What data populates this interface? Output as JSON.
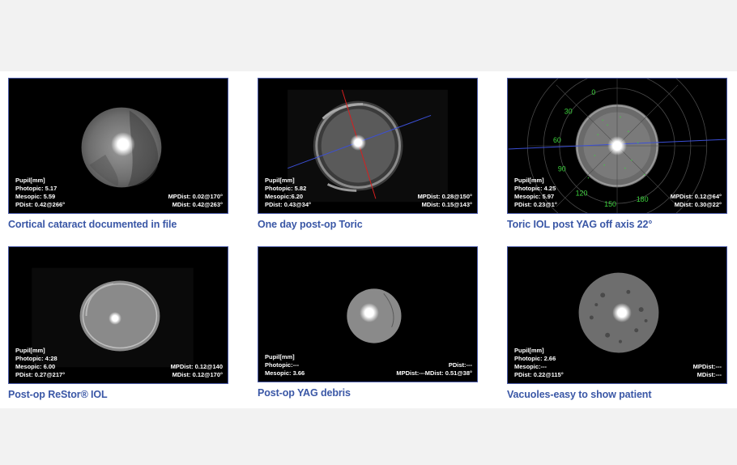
{
  "panels": [
    {
      "caption": "Cortical cataract documented in file",
      "left": [
        "Pupil[mm]",
        "Photopic: 5.17",
        "Mesopic: 5.59",
        "PDist: 0.42@266°"
      ],
      "right": [
        "MPDist: 0.02@170°",
        "MDist: 0.42@263°"
      ]
    },
    {
      "caption": "One day post-op Toric",
      "left": [
        "Pupil[mm]",
        "Photopic: 5.82",
        "Mesopic:6.20",
        "PDist: 0.43@34°"
      ],
      "right": [
        "MPDist: 0.28@150°",
        "MDist: 0.15@143°"
      ]
    },
    {
      "caption": "Toric IOL post YAG off axis 22°",
      "left": [
        "Pupil[mm]",
        "Photopic: 4.25",
        "Mesopic: 5.97",
        "PDist: 0.23@1°"
      ],
      "right": [
        "MPDist: 0.12@64°",
        "MDist: 0.30@22°"
      ],
      "axis_labels": [
        "0",
        "30",
        "60",
        "90",
        "120",
        "150",
        "180"
      ]
    },
    {
      "caption": "Post-op ReStor® IOL",
      "left": [
        "Pupil[mm]",
        "Photopic: 4:28",
        "Mesopic: 6.00",
        "PDist: 0.27@217°"
      ],
      "right": [
        "MPDist: 0.12@140",
        "MDist: 0.12@170°"
      ]
    },
    {
      "caption": "Post-op YAG debris",
      "left": [
        "Pupil[mm]",
        "Photopic:---",
        "Mesopic: 3.66"
      ],
      "right": [
        "PDist:---",
        "MPDist:---MDist: 0.51@38°"
      ]
    },
    {
      "caption": "Vacuoles-easy to show patient",
      "left": [
        "Pupil[mm]",
        "Photopic: 2.66",
        "Mesopic:---",
        "PDist: 0.22@115°"
      ],
      "right": [
        "MPDist:---",
        "MDist:---"
      ]
    }
  ]
}
